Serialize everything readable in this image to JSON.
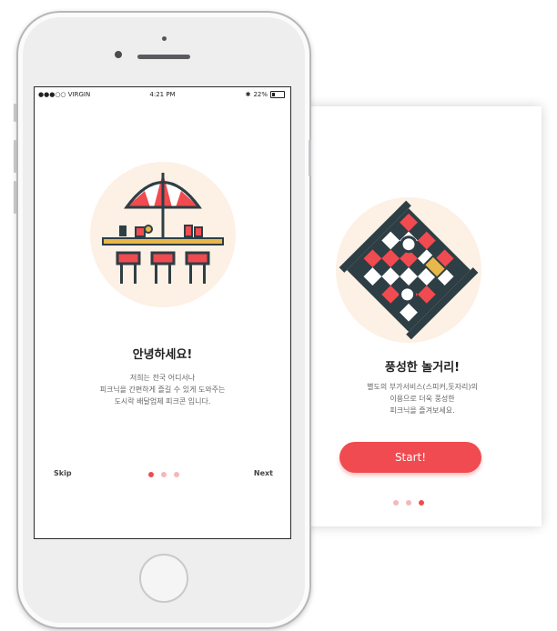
{
  "status_bar": {
    "carrier": "●●●○○ VIRGIN",
    "time": "4:21 PM",
    "battery": "22%"
  },
  "screen1": {
    "title": "안녕하세요!",
    "description": "저희는 전국 어디서나\n피크닉을 간편하게 즐길 수 있게 도와주는\n도시락 배달업체 피크콘 입니다.",
    "skip_label": "Skip",
    "next_label": "Next",
    "page_index": 1,
    "page_count": 3
  },
  "screen2": {
    "title": "풍성한 놀거리!",
    "description": "별도의 부가서비스(스피커,돗자리)의\n이용으로 더욱 풍성한\n피크닉을 즐겨보세요.",
    "start_label": "Start!",
    "page_index": 3,
    "page_count": 3
  },
  "colors": {
    "accent": "#ef4b50",
    "illustration_bg": "#fdf0e4",
    "dark": "#2e3e45",
    "table": "#e8b84a"
  }
}
